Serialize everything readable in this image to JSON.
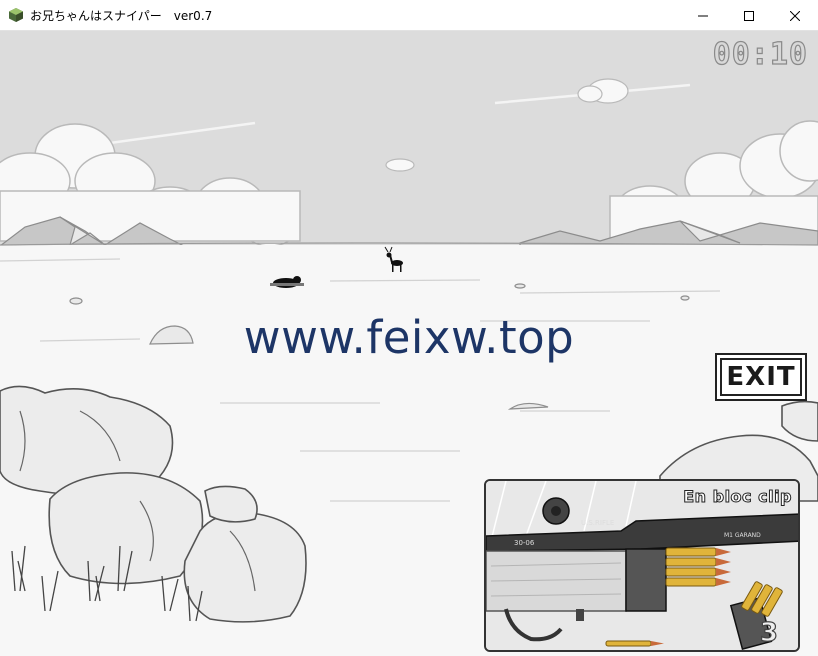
{
  "window": {
    "title": "お兄ちゃんはスナイパー　ver0.7",
    "buttons": [
      "minimize",
      "maximize",
      "close"
    ]
  },
  "hud": {
    "timer": "00:10",
    "exit_label": "EXIT"
  },
  "watermark": "www.feixw.top",
  "ammo_panel": {
    "title": "En bloc clip",
    "rounds_remaining": "3",
    "rifle_markings": {
      "model": "U.S.RIFLE",
      "caliber": "30-06",
      "maker": "M1 GARAND"
    }
  },
  "colors": {
    "sky": "#dcdcdc",
    "ground": "#f7f7f7",
    "brass": "#e0b43a",
    "watermark": "#1d3566"
  }
}
